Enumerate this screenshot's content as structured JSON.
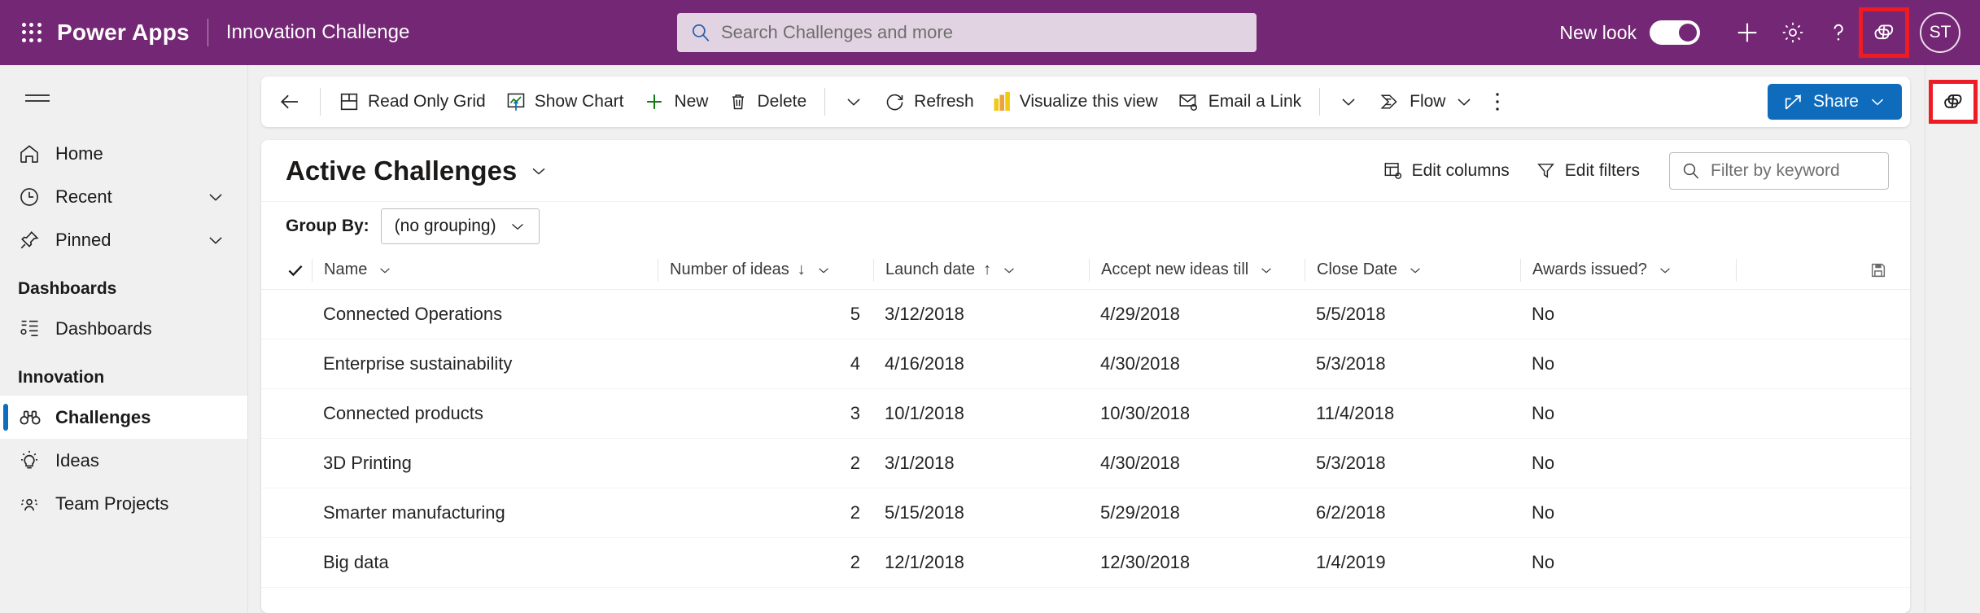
{
  "header": {
    "waffle_icon": "app-launcher-icon",
    "brand": "Power Apps",
    "app_name": "Innovation Challenge",
    "search": {
      "icon": "search-icon",
      "placeholder": "Search Challenges and more",
      "value": ""
    },
    "new_look_label": "New look",
    "new_look_on": true,
    "icons": [
      "plus-icon",
      "gear-icon",
      "question-icon",
      "copilot-icon"
    ],
    "avatar_initials": "ST",
    "bar_color": "#742774",
    "search_bg": "#e2d3e2",
    "highlight_color": "#ed1c24"
  },
  "sidebar": {
    "hamburger_icon": "hamburger-menu-icon",
    "items": [
      {
        "label": "Home",
        "icon": "home-icon",
        "chevron": false,
        "active": false
      },
      {
        "label": "Recent",
        "icon": "clock-icon",
        "chevron": true,
        "active": false
      },
      {
        "label": "Pinned",
        "icon": "pin-icon",
        "chevron": true,
        "active": false
      }
    ],
    "groups": [
      {
        "title": "Dashboards",
        "items": [
          {
            "label": "Dashboards",
            "icon": "dashboard-icon",
            "active": false
          }
        ]
      },
      {
        "title": "Innovation",
        "items": [
          {
            "label": "Challenges",
            "icon": "binoculars-icon",
            "active": true
          },
          {
            "label": "Ideas",
            "icon": "lightbulb-icon",
            "active": false
          },
          {
            "label": "Team Projects",
            "icon": "people-icon",
            "active": false
          }
        ]
      }
    ],
    "active_accent": "#0f6cbd"
  },
  "commandbar": {
    "back_icon": "back-arrow-icon",
    "buttons": [
      {
        "label": "Read Only Grid",
        "icon": "grid-icon"
      },
      {
        "label": "Show Chart",
        "icon": "chart-icon"
      },
      {
        "label": "New",
        "icon": "plus-icon"
      },
      {
        "label": "Delete",
        "icon": "trash-icon"
      }
    ],
    "overflow_chevron": "chevron-down-icon",
    "buttons2": [
      {
        "label": "Refresh",
        "icon": "refresh-icon"
      },
      {
        "label": "Visualize this view",
        "icon": "powerbi-icon"
      },
      {
        "label": "Email a Link",
        "icon": "email-icon"
      }
    ],
    "email_chevron": "chevron-down-icon",
    "flow": {
      "label": "Flow",
      "icon": "flow-icon",
      "chevron": "chevron-down-icon"
    },
    "more_icon": "more-vertical-icon",
    "share": {
      "label": "Share",
      "icon": "share-icon",
      "chevron": "chevron-down-icon",
      "color": "#0f6cbd"
    }
  },
  "view": {
    "title": "Active Challenges",
    "title_chevron": "chevron-down-icon",
    "edit_columns": {
      "label": "Edit columns",
      "icon": "edit-columns-icon"
    },
    "edit_filters": {
      "label": "Edit filters",
      "icon": "filter-icon"
    },
    "keyword_filter": {
      "icon": "search-icon",
      "placeholder": "Filter by keyword",
      "value": ""
    },
    "group_by_label": "Group By:",
    "group_by_value": "(no grouping)",
    "group_by_chevron": "chevron-down-icon"
  },
  "grid": {
    "select_all_icon": "checkmark-icon",
    "save_icon": "save-floppy-icon",
    "columns": [
      {
        "label": "Name",
        "sort": "",
        "chevron": "chevron-down-icon"
      },
      {
        "label": "Number of ideas",
        "sort": "↓",
        "chevron": "chevron-down-icon"
      },
      {
        "label": "Launch date",
        "sort": "↑",
        "chevron": "chevron-down-icon"
      },
      {
        "label": "Accept new ideas till",
        "sort": "",
        "chevron": "chevron-down-icon"
      },
      {
        "label": "Close Date",
        "sort": "",
        "chevron": "chevron-down-icon"
      },
      {
        "label": "Awards issued?",
        "sort": "",
        "chevron": "chevron-down-icon"
      }
    ],
    "rows": [
      {
        "name": "Connected Operations",
        "ideas": "5",
        "launch": "3/12/2018",
        "accept": "4/29/2018",
        "close": "5/5/2018",
        "awards": "No"
      },
      {
        "name": "Enterprise sustainability",
        "ideas": "4",
        "launch": "4/16/2018",
        "accept": "4/30/2018",
        "close": "5/3/2018",
        "awards": "No"
      },
      {
        "name": "Connected products",
        "ideas": "3",
        "launch": "10/1/2018",
        "accept": "10/30/2018",
        "close": "11/4/2018",
        "awards": "No"
      },
      {
        "name": "3D Printing",
        "ideas": "2",
        "launch": "3/1/2018",
        "accept": "4/30/2018",
        "close": "5/3/2018",
        "awards": "No"
      },
      {
        "name": "Smarter manufacturing",
        "ideas": "2",
        "launch": "5/15/2018",
        "accept": "5/29/2018",
        "close": "6/2/2018",
        "awards": "No"
      },
      {
        "name": "Big data",
        "ideas": "2",
        "launch": "12/1/2018",
        "accept": "12/30/2018",
        "close": "1/4/2019",
        "awards": "No"
      }
    ]
  },
  "right_rail": {
    "copilot_icon": "copilot-icon"
  }
}
